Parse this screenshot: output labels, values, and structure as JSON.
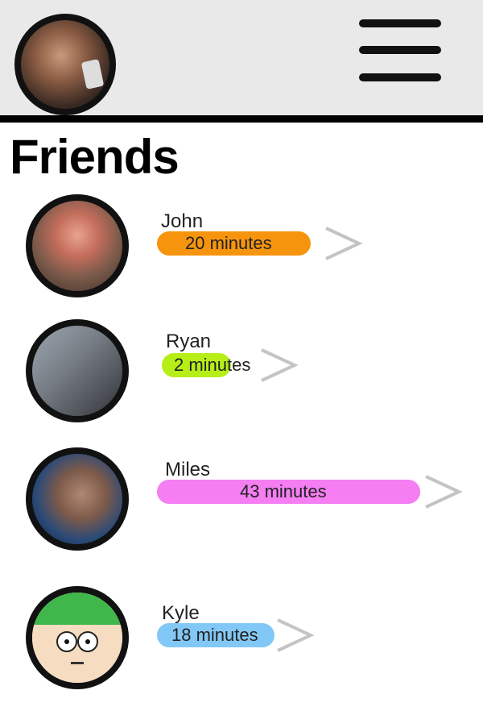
{
  "header": {
    "profile_avatar_icon": "person-photo",
    "menu_icon": "hamburger-menu-icon"
  },
  "page": {
    "title": "Friends"
  },
  "friends": [
    {
      "name": "John",
      "time": "20 minutes",
      "color": "#f7940e",
      "avatar": "man-with-beer-photo"
    },
    {
      "name": "Ryan",
      "time": "2 minutes",
      "color": "#b6ee18",
      "avatar": "group-selfie-photo"
    },
    {
      "name": "Miles",
      "time": "43 minutes",
      "color": "#f47ef2",
      "avatar": "gray-haired-man-photo"
    },
    {
      "name": "Kyle",
      "time": "18 minutes",
      "color": "#82c8f6",
      "avatar": "cartoon-boy-green-hat"
    }
  ],
  "chevron_icon": "chevron-right-icon",
  "chevron_color": "#c4c4c4"
}
